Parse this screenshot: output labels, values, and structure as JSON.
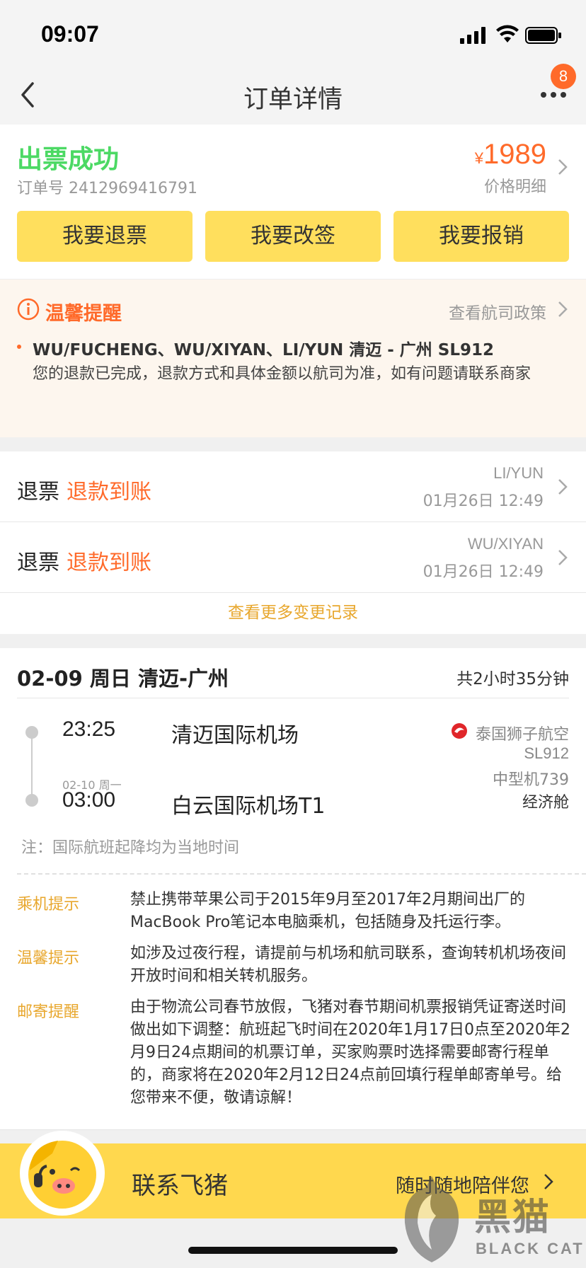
{
  "status_bar": {
    "time": "09:07"
  },
  "nav": {
    "title": "订单详情",
    "badge_count": "8"
  },
  "order": {
    "status": "出票成功",
    "order_no_label": "订单号",
    "order_no": "2412969416791",
    "currency": "¥",
    "price": "1989",
    "price_detail": "价格明细",
    "buttons": [
      "我要退票",
      "我要改签",
      "我要报销"
    ]
  },
  "tip": {
    "title": "温馨提醒",
    "link": "查看航司政策",
    "passengers_route": "WU/FUCHENG、WU/XIYAN、LI/YUN 清迈 - 广州 SL912",
    "message": "您的退款已完成，退款方式和具体金额以航司为准，如有问题请联系商家"
  },
  "refunds": {
    "rows": [
      {
        "label": "退票",
        "status": "退款到账",
        "name": "LI/YUN",
        "time": "01月26日 12:49"
      },
      {
        "label": "退票",
        "status": "退款到账",
        "name": "WU/XIYAN",
        "time": "01月26日 12:49"
      }
    ],
    "more": "查看更多变更记录"
  },
  "flight": {
    "route": "02-09 周日 清迈-广州",
    "duration": "共2小时35分钟",
    "dep_time": "23:25",
    "dep_airport": "清迈国际机场",
    "arr_date": "02-10 周一",
    "arr_time": "03:00",
    "arr_airport": "白云国际机场T1",
    "airline": "泰国狮子航空",
    "flight_no": "SL912",
    "aircraft": "中型机739",
    "cabin": "经济舱",
    "note": "注：国际航班起降均为当地时间",
    "notices": [
      {
        "label": "乘机提示",
        "text": "禁止携带苹果公司于2015年9月至2017年2月期间出厂的MacBook Pro笔记本电脑乘机，包括随身及托运行李。"
      },
      {
        "label": "温馨提示",
        "text": "如涉及过夜行程，请提前与机场和航司联系，查询转机机场夜间开放时间和相关转机服务。"
      },
      {
        "label": "邮寄提醒",
        "text": "由于物流公司春节放假，飞猪对春节期间机票报销凭证寄送时间做出如下调整：航班起飞时间在2020年1月17日0点至2020年2月9日24点期间的机票订单，买家购票时选择需要邮寄行程单的，商家将在2020年2月12日24点前回填行程单邮寄单号。给您带来不便，敬请谅解！"
      }
    ]
  },
  "contact": {
    "title": "联系飞猪",
    "subtitle": "随时随地陪伴您"
  },
  "watermark": {
    "cn": "黑猫",
    "en": "BLACK CAT"
  },
  "colors": {
    "accent_orange": "#ff6a2a",
    "success_green": "#4cd964",
    "button_yellow": "#ffdf5d",
    "link_gold": "#e8a72d"
  }
}
